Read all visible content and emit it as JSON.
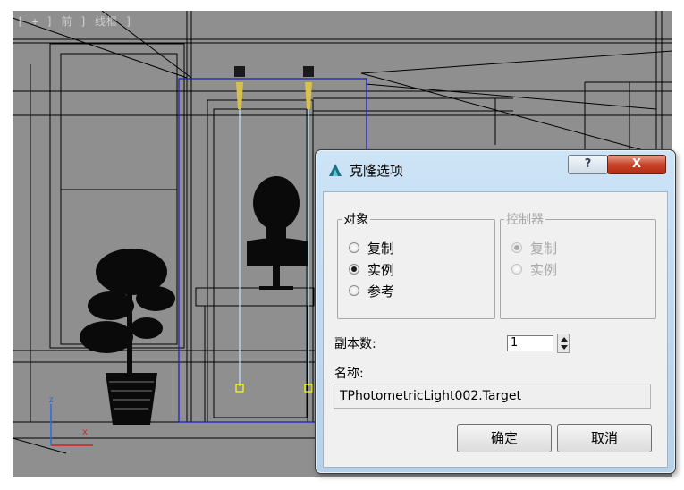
{
  "viewport": {
    "label": "[ + ] 前 ] 线框 ]",
    "axis_z": "z",
    "axis_x": "x",
    "colors": {
      "background": "#8f8f8f",
      "wire": "#000000",
      "selection": "#2020d0",
      "light_line": "#bfe6ff",
      "target": "#ffff00"
    }
  },
  "dialog": {
    "title": "克隆选项",
    "help_glyph": "?",
    "close_glyph": "X",
    "object_group": {
      "legend": "对象",
      "options": [
        {
          "label": "复制",
          "checked": false
        },
        {
          "label": "实例",
          "checked": true
        },
        {
          "label": "参考",
          "checked": false
        }
      ]
    },
    "controller_group": {
      "legend": "控制器",
      "enabled": false,
      "options": [
        {
          "label": "复制",
          "checked": true
        },
        {
          "label": "实例",
          "checked": false
        }
      ]
    },
    "copies_label": "副本数:",
    "copies_value": "1",
    "name_label": "名称:",
    "name_value": "TPhotometricLight002.Target",
    "ok_label": "确定",
    "cancel_label": "取消"
  }
}
